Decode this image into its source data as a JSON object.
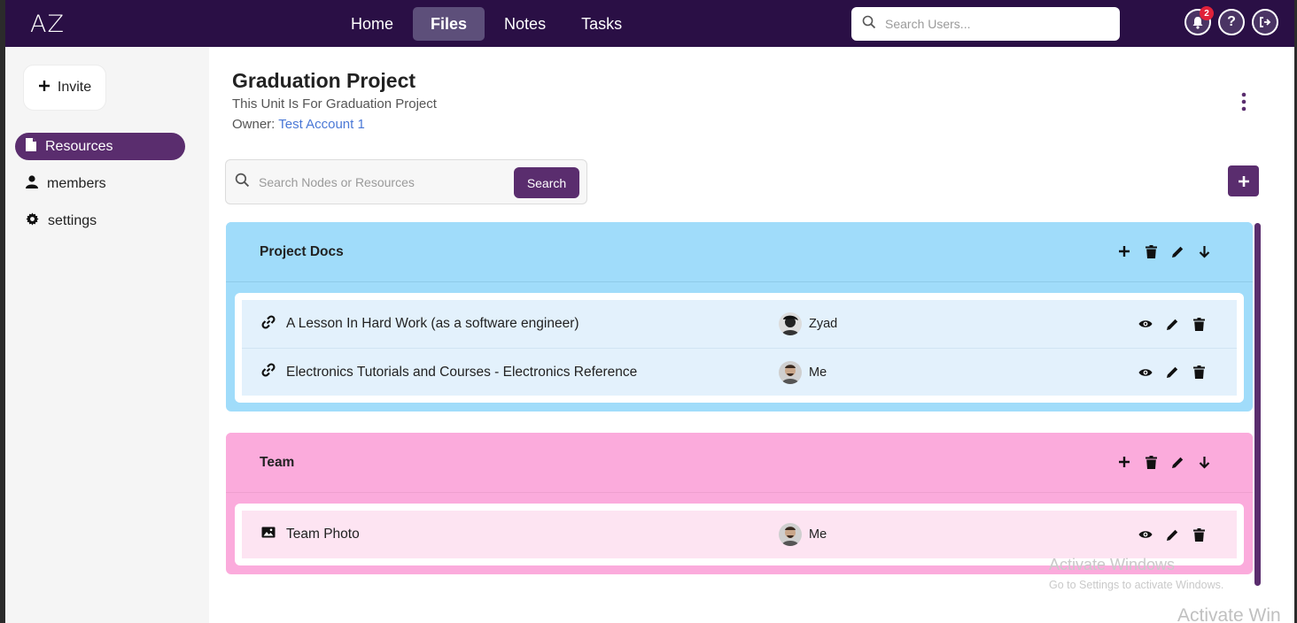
{
  "app": {
    "logo": "AZ",
    "nav": [
      "Home",
      "Files",
      "Notes",
      "Tasks"
    ],
    "active_nav": "Files",
    "search_placeholder": "Search Users...",
    "notification_count": "2",
    "help_label": "?"
  },
  "sidebar": {
    "invite_label": "Invite",
    "items": [
      {
        "label": "Resources",
        "icon": "file-icon",
        "active": true
      },
      {
        "label": "members",
        "icon": "user-icon",
        "active": false
      },
      {
        "label": "settings",
        "icon": "gear-icon",
        "active": false
      }
    ]
  },
  "project": {
    "title": "Graduation Project",
    "description": "This Unit Is For Graduation Project",
    "owner_label": "Owner:",
    "owner_name": "Test Account 1"
  },
  "resource_search": {
    "placeholder": "Search Nodes or Resources",
    "button_label": "Search"
  },
  "nodes": [
    {
      "name": "Project Docs",
      "color": "#a0dcfa",
      "resources": [
        {
          "type": "link-icon",
          "name": "A Lesson In Hard Work (as a software engineer)",
          "owner": "Zyad"
        },
        {
          "type": "link-icon",
          "name": "Electronics Tutorials and Courses - Electronics Reference",
          "owner": "Me"
        }
      ]
    },
    {
      "name": "Team",
      "color": "#fbabdc",
      "resources": [
        {
          "type": "image-icon",
          "name": "Team Photo",
          "owner": "Me"
        }
      ]
    }
  ],
  "watermark": {
    "line1": "Activate Windows",
    "line2": "Go to Settings to activate Windows.",
    "line3": "Activate Win"
  },
  "colors": {
    "topbar": "#2a0f45",
    "accent": "#5a2d6e",
    "link": "#4a78d6"
  }
}
